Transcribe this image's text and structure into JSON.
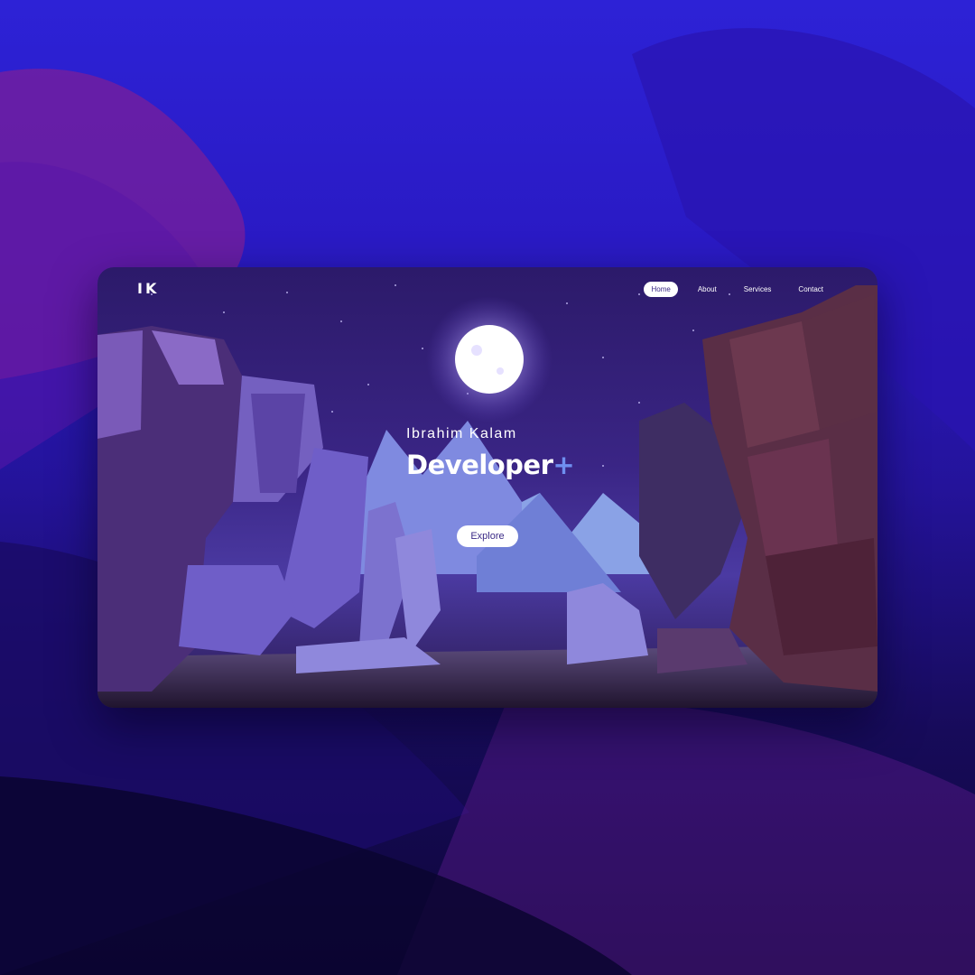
{
  "brand": {
    "logo_text": "IK"
  },
  "nav": {
    "items": [
      {
        "label": "Home",
        "active": true
      },
      {
        "label": "About",
        "active": false
      },
      {
        "label": "Services",
        "active": false
      },
      {
        "label": "Contact",
        "active": false
      }
    ]
  },
  "hero": {
    "name": "Ibrahim Kalam",
    "title": "Developer",
    "title_suffix": "+",
    "cta_label": "Explore"
  },
  "colors": {
    "accent": "#6f8ff0",
    "night_sky": "#2c1a6a",
    "moon": "#ffffff"
  },
  "icons": [
    "moon-illustration",
    "stars-illustration",
    "rock-cliffs-illustration",
    "mountain-illustration"
  ]
}
